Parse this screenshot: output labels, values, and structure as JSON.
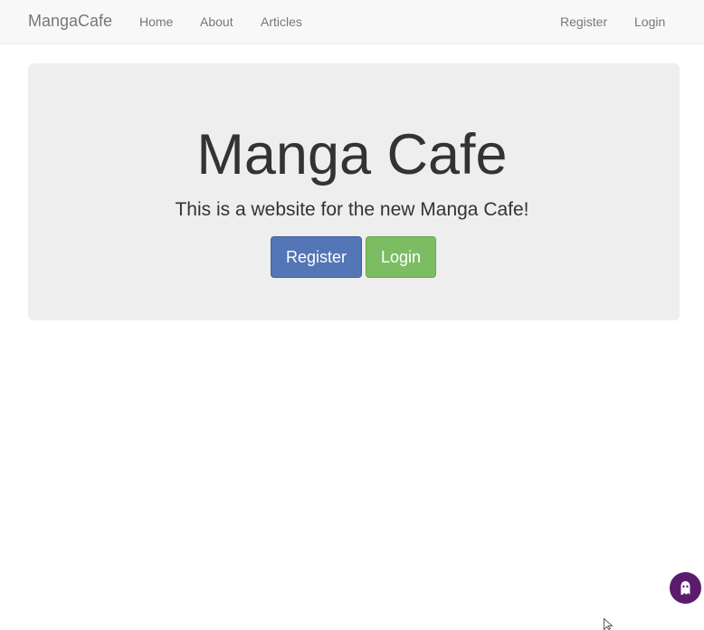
{
  "navbar": {
    "brand": "MangaCafe",
    "links": [
      {
        "label": "Home"
      },
      {
        "label": "About"
      },
      {
        "label": "Articles"
      }
    ],
    "right_links": [
      {
        "label": "Register"
      },
      {
        "label": "Login"
      }
    ]
  },
  "hero": {
    "title": "Manga Cafe",
    "subtitle": "This is a website for the new Manga Cafe!",
    "register_label": "Register",
    "login_label": "Login"
  },
  "widgets": {
    "chat_icon": "ghost-icon",
    "cursor_icon": "mouse-pointer-icon"
  },
  "colors": {
    "navbar_bg": "#f8f8f8",
    "jumbotron_bg": "#eeeeee",
    "primary": "#5475b6",
    "success": "#7cbc63",
    "chat_bubble": "#5c1c6e"
  }
}
